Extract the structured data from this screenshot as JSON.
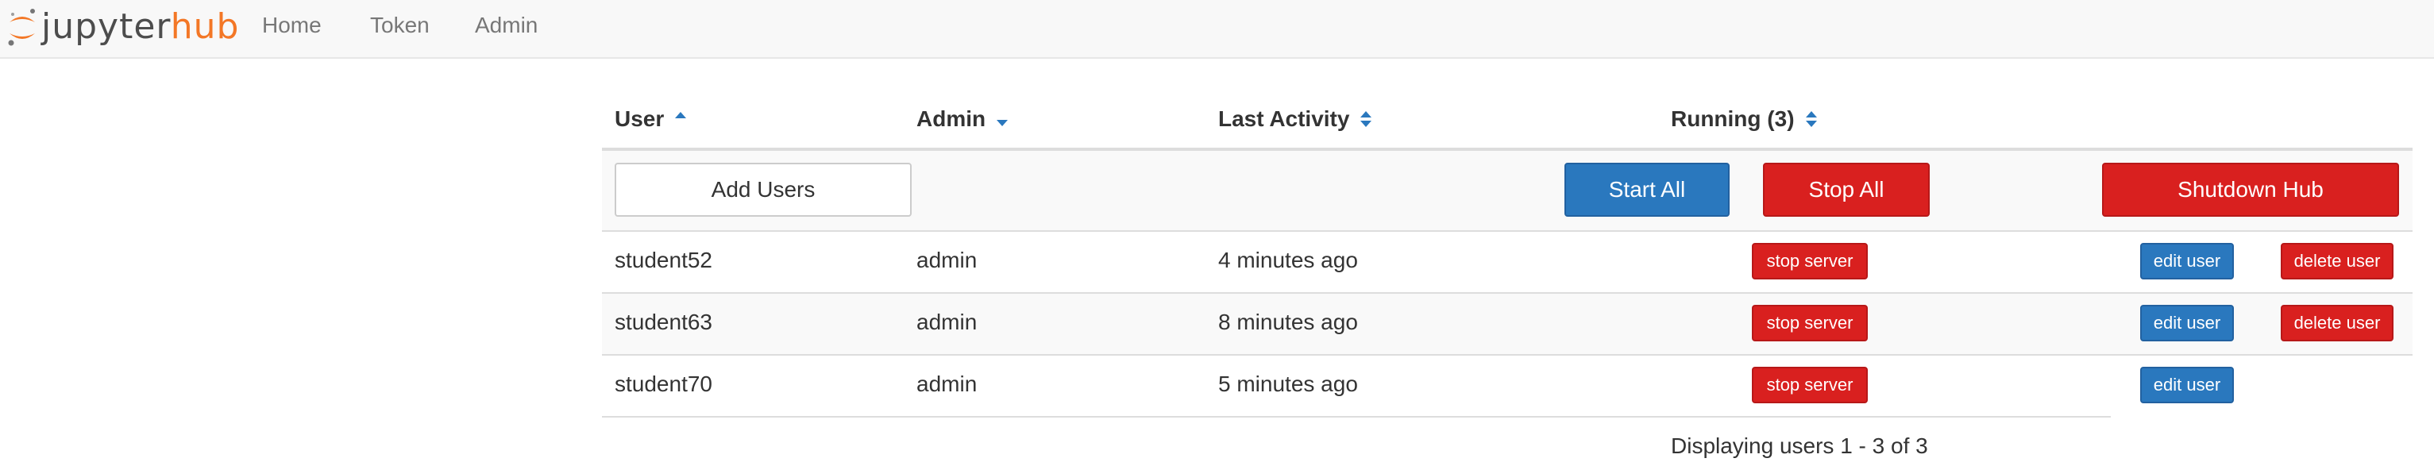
{
  "app": {
    "logo_jupyter": "jupyter",
    "logo_hub": "hub",
    "accent_color": "#f37726"
  },
  "nav": {
    "home": "Home",
    "token": "Token",
    "admin": "Admin"
  },
  "table": {
    "headers": {
      "user": "User",
      "admin": "Admin",
      "last_activity": "Last Activity",
      "running": "Running (3)"
    },
    "sort": {
      "user": "ascending",
      "admin": "descending",
      "last_activity": "none",
      "running": "none"
    },
    "actions": {
      "add_users": "Add Users",
      "start_all": "Start All",
      "stop_all": "Stop All",
      "shutdown_hub": "Shutdown Hub"
    },
    "rows": [
      {
        "name": "student52",
        "admin": "admin",
        "last_activity": "4 minutes ago",
        "server_button": "stop server",
        "edit_button": "edit user",
        "delete_button": "delete user"
      },
      {
        "name": "student63",
        "admin": "admin",
        "last_activity": "8 minutes ago",
        "server_button": "stop server",
        "edit_button": "edit user",
        "delete_button": "delete user"
      },
      {
        "name": "student70",
        "admin": "admin",
        "last_activity": "5 minutes ago",
        "server_button": "stop server",
        "edit_button": "edit user",
        "delete_button": ""
      }
    ],
    "footer": "Displaying users 1 - 3 of 3"
  },
  "colors": {
    "primary_blue": "#2a78be",
    "danger_red": "#d9201f",
    "navbar_bg": "#f8f8f8"
  }
}
